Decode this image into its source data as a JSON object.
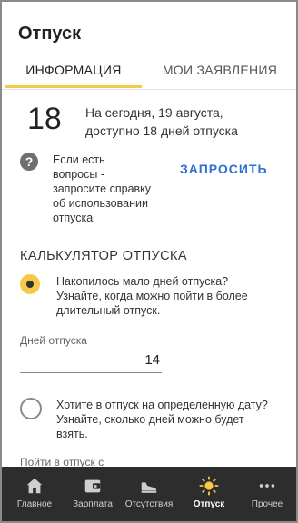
{
  "header": {
    "title": "Отпуск"
  },
  "tabs": [
    {
      "label": "ИНФОРМАЦИЯ"
    },
    {
      "label": "МОИ ЗАЯВЛЕНИЯ"
    }
  ],
  "summary": {
    "days": "18",
    "line1": "На сегодня, 19 августа,",
    "line2": "доступно 18 дней отпуска"
  },
  "help": {
    "icon": "?",
    "lines": [
      "Если есть",
      "вопросы -",
      "запросите справку",
      "об использовании",
      "отпуска"
    ],
    "button_label": "ЗАПРОСИТЬ"
  },
  "calculator": {
    "title": "КАЛЬКУЛЯТОР ОТПУСКА",
    "option1_lines": [
      "Накопилось мало дней отпуска?",
      "Узнайте, когда можно пойти в более",
      "длительный отпуск."
    ],
    "field_label": "Дней отпуска",
    "field_value": "14",
    "option2_lines": [
      "Хотите в отпуск на определенную дату?",
      "Узнайте, сколько дней можно будет",
      "взять."
    ],
    "date_label": "Пойти в отпуск с"
  },
  "nav": {
    "items": [
      {
        "label": "Главное",
        "icon": "home-icon"
      },
      {
        "label": "Зарплата",
        "icon": "wallet-icon"
      },
      {
        "label": "Отсутствия",
        "icon": "sneaker-icon"
      },
      {
        "label": "Отпуск",
        "icon": "sun-icon"
      },
      {
        "label": "Прочее",
        "icon": "more-dots-icon"
      }
    ],
    "active": "Отпуск"
  },
  "colors": {
    "accent": "#f7c948",
    "link": "#2f6fd8",
    "nav_bg": "#2d2d2d"
  }
}
